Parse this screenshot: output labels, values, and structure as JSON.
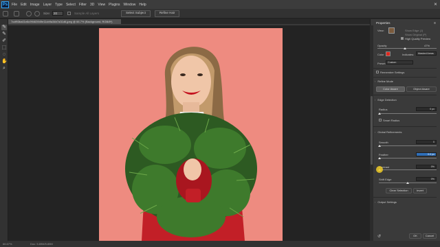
{
  "menubar": {
    "items": [
      "File",
      "Edit",
      "Image",
      "Layer",
      "Type",
      "Select",
      "Filter",
      "3D",
      "View",
      "Plugins",
      "Window",
      "Help"
    ]
  },
  "options": {
    "size_label": "Size:",
    "size_value": "20",
    "sample_all_label": "Sample All Layers",
    "select_subject": "Select Subject",
    "refine_hair": "Refine Hair"
  },
  "document": {
    "tab_title": "7cdf93ba01e8c99463949e11cb9a34b7a31d6.jpeg @ 66.7% (Background, RGB/8*)",
    "zoom": "66.67%",
    "doc_info": "Doc: 5.89M/5.89M"
  },
  "panel": {
    "title": "Properties",
    "view_label": "View:",
    "show_edge": "Show Edge (J)",
    "show_original": "Show Original (P)",
    "hq_preview": "High Quality Preview",
    "opacity_label": "Opacity",
    "opacity_value": "47%",
    "color_label": "Color",
    "color_value": "#e0281e",
    "indicates_label": "Indicates:",
    "indicates_value": "Masked Areas",
    "preset_label": "Preset",
    "preset_value": "Custom",
    "remember": "Remember Settings",
    "refine_mode": "Refine Mode",
    "color_aware": "Color Aware",
    "object_aware": "Object Aware",
    "edge_detection": "Edge Detection",
    "radius_label": "Radius",
    "radius_value": "0 px",
    "smart_radius": "Smart Radius",
    "global_refinements": "Global Refinements",
    "smooth_label": "Smooth",
    "smooth_value": "0",
    "feather_label": "Feather",
    "feather_value": "0.0 px",
    "contrast_label": "Contrast",
    "contrast_value": "0%",
    "shift_label": "Shift Edge",
    "shift_value": "0%",
    "clear_selection": "Clear Selection",
    "invert": "Invert",
    "output_settings": "Output Settings",
    "ok": "OK",
    "cancel": "Cancel"
  }
}
